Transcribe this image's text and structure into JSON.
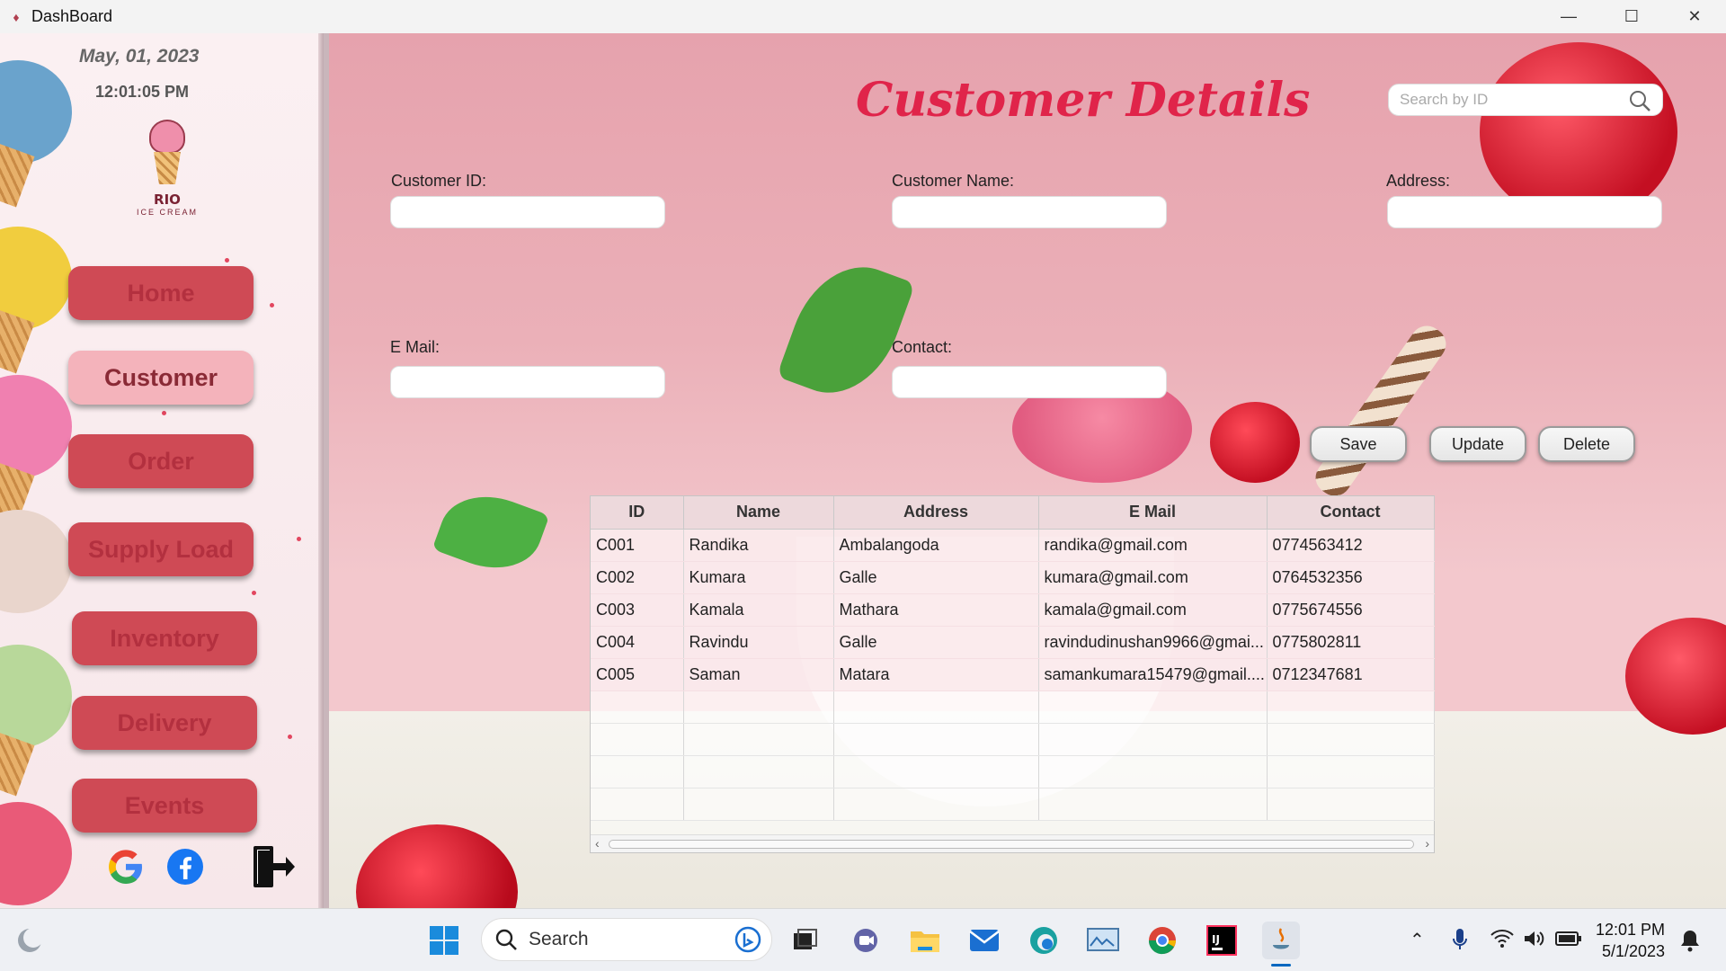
{
  "window": {
    "title": "DashBoard",
    "minimize": "—",
    "maximize": "☐",
    "close": "✕"
  },
  "sidebar": {
    "date": "May,  01, 2023",
    "time": "12:01:05 PM",
    "logo": {
      "brand": "RIO",
      "sub": "ICE CREAM"
    },
    "items": [
      {
        "label": "Home",
        "active": false
      },
      {
        "label": "Customer",
        "active": true
      },
      {
        "label": "Order",
        "active": false
      },
      {
        "label": "Supply Load",
        "active": false
      },
      {
        "label": "Inventory",
        "active": false
      },
      {
        "label": "Delivery",
        "active": false
      },
      {
        "label": "Events",
        "active": false
      }
    ],
    "icons": [
      "google-icon",
      "facebook-icon",
      "logout-icon"
    ]
  },
  "main": {
    "title": "Customer Details",
    "search": {
      "placeholder": "Search by ID",
      "value": ""
    },
    "fields": {
      "customer_id": {
        "label": "Customer ID:",
        "value": ""
      },
      "customer_name": {
        "label": "Customer Name:",
        "value": ""
      },
      "address": {
        "label": "Address:",
        "value": ""
      },
      "email": {
        "label": "E Mail:",
        "value": ""
      },
      "contact": {
        "label": "Contact:",
        "value": ""
      }
    },
    "buttons": {
      "save": "Save",
      "update": "Update",
      "delete": "Delete"
    },
    "table": {
      "columns": [
        "ID",
        "Name",
        "Address",
        "E Mail",
        "Contact"
      ],
      "rows": [
        [
          "C001",
          "Randika",
          "Ambalangoda",
          "randika@gmail.com",
          "0774563412"
        ],
        [
          "C002",
          "Kumara",
          "Galle",
          "kumara@gmail.com",
          "0764532356"
        ],
        [
          "C003",
          "Kamala",
          "Mathara",
          "kamala@gmail.com",
          "0775674556"
        ],
        [
          "C004",
          "Ravindu",
          "Galle",
          "ravindudinushan9966@gmai...",
          "0775802811"
        ],
        [
          "C005",
          "Saman",
          "Matara",
          "samankumara15479@gmail....",
          "0712347681"
        ]
      ]
    }
  },
  "taskbar": {
    "search_label": "Search",
    "clock_time": "12:01 PM",
    "clock_date": "5/1/2023",
    "colors": {
      "accent": "#0067c0",
      "title_red": "#e0244a",
      "nav_red": "#cf4a55"
    }
  }
}
